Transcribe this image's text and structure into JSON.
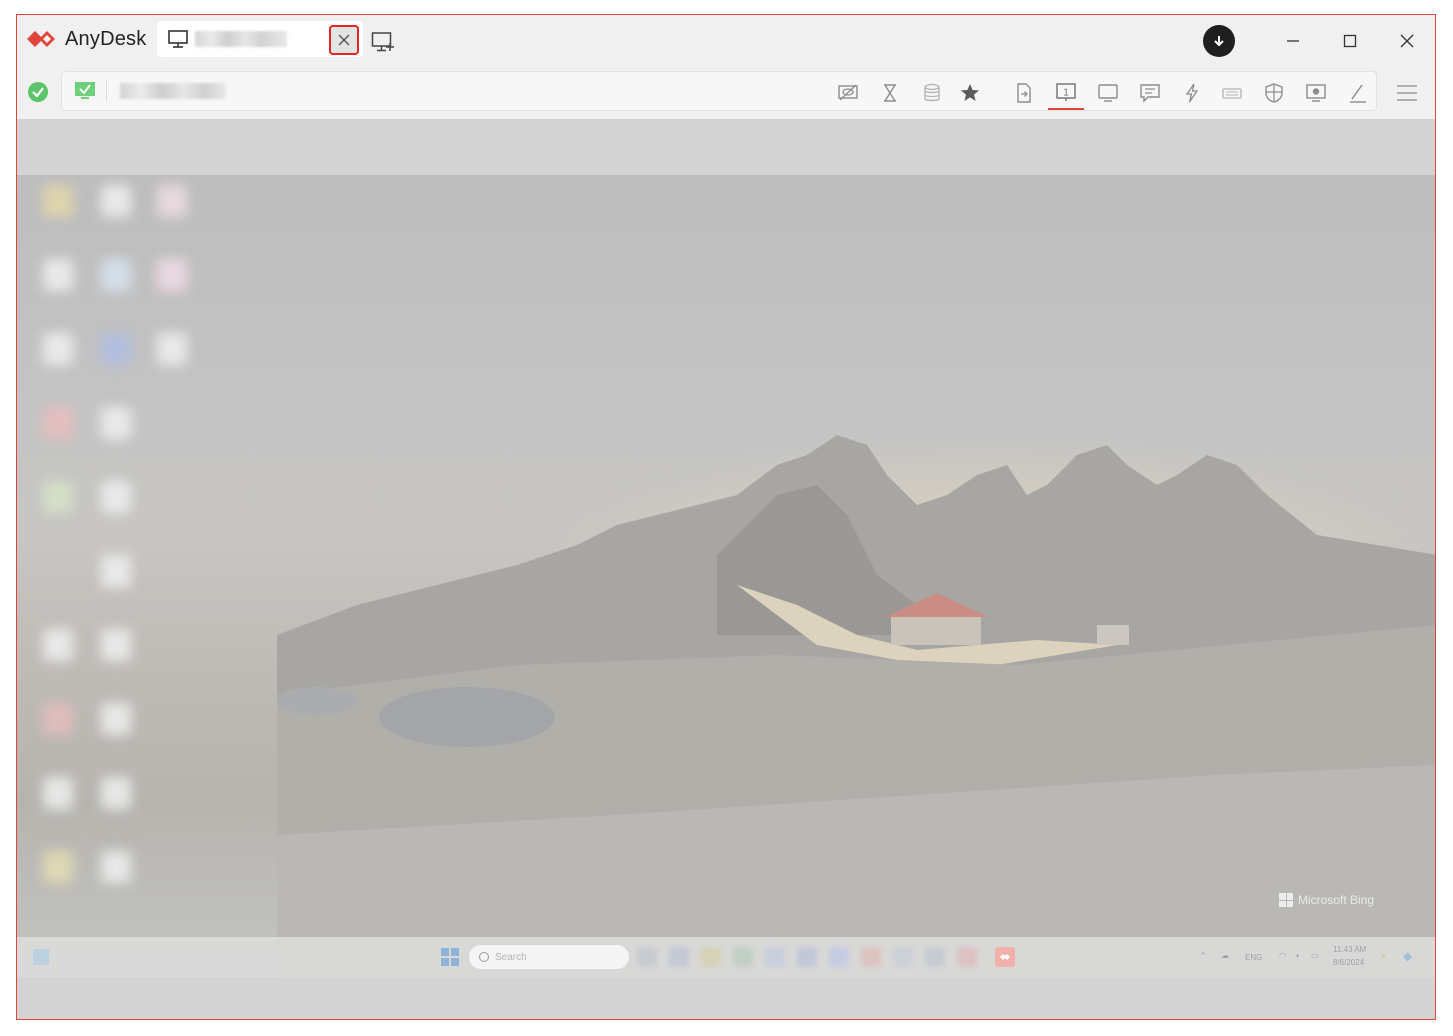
{
  "app": {
    "name": "AnyDesk",
    "accent_color": "#e0453b"
  },
  "tab": {
    "session_label": "",
    "close_icon": "close-icon"
  },
  "toolbar": {
    "address_label": "",
    "tools": [
      {
        "name": "privacy-mode-icon"
      },
      {
        "name": "hourglass-icon"
      },
      {
        "name": "database-icon"
      },
      {
        "name": "favorite-star-icon"
      },
      {
        "name": "file-transfer-icon"
      },
      {
        "name": "monitor-1-icon",
        "label": "1",
        "active": true
      },
      {
        "name": "display-icon"
      },
      {
        "name": "chat-icon"
      },
      {
        "name": "actions-lightning-icon"
      },
      {
        "name": "keyboard-icon"
      },
      {
        "name": "permissions-shield-icon"
      },
      {
        "name": "record-session-icon"
      },
      {
        "name": "whiteboard-pen-icon"
      }
    ]
  },
  "remote": {
    "watermark": "Microsoft Bing",
    "taskbar": {
      "search_placeholder": "Search",
      "language": "ENG",
      "time": "11:43 AM",
      "date": "8/6/2024"
    }
  }
}
